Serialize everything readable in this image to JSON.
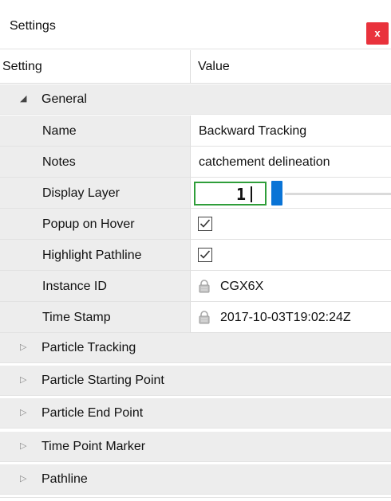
{
  "window": {
    "title": "Settings",
    "close_label": "x"
  },
  "columns": {
    "setting": "Setting",
    "value": "Value"
  },
  "general": {
    "label": "General",
    "expanded": true,
    "name": {
      "label": "Name",
      "value": "Backward Tracking"
    },
    "notes": {
      "label": "Notes",
      "value": "catchement delineation"
    },
    "display_layer": {
      "label": "Display Layer",
      "value": "1"
    },
    "popup_on_hover": {
      "label": "Popup on Hover",
      "checked": true
    },
    "highlight_pathline": {
      "label": "Highlight Pathline",
      "checked": true
    },
    "instance_id": {
      "label": "Instance ID",
      "value": "CGX6X",
      "icon": "lock-icon"
    },
    "time_stamp": {
      "label": "Time Stamp",
      "value": "2017-10-03T19:02:24Z",
      "icon": "lock-icon"
    }
  },
  "groups": [
    {
      "label": "Particle Tracking",
      "expanded": false
    },
    {
      "label": "Particle Starting Point",
      "expanded": false
    },
    {
      "label": "Particle End Point",
      "expanded": false
    },
    {
      "label": "Time Point Marker",
      "expanded": false
    },
    {
      "label": "Pathline",
      "expanded": false
    }
  ],
  "colors": {
    "close_button": "#e9323c",
    "slider_thumb": "#0a74d6",
    "focus_border": "#2f9e3a",
    "category_background": "#ededed"
  }
}
